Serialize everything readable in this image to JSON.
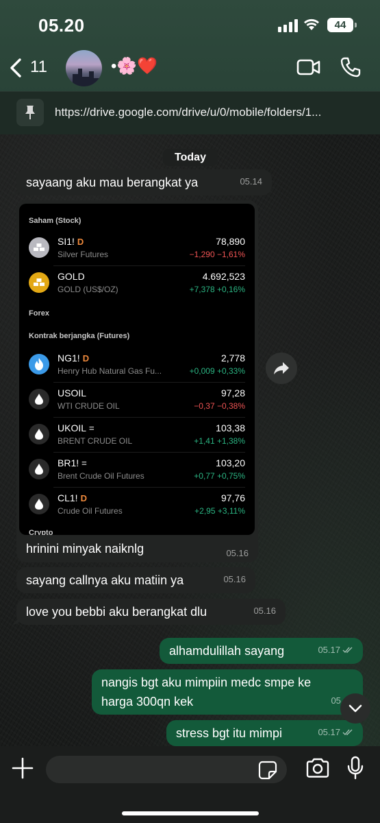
{
  "status": {
    "time": "05.20",
    "battery": "44"
  },
  "nav": {
    "back_count": "11",
    "contact_name": "•🌸❤️"
  },
  "pinned": {
    "text": "https://drive.google.com/drive/u/0/mobile/folders/1..."
  },
  "chat": {
    "date_chip": "Today",
    "messages": [
      {
        "text": "sayaang aku mau berangkat ya",
        "time": "05.14"
      },
      {
        "text": "hrinini minyak naiknlg",
        "time": "05.16"
      },
      {
        "text": "sayang callnya aku matiin ya",
        "time": "05.16"
      },
      {
        "text": "love you bebbi aku berangkat dlu",
        "time": "05.16"
      },
      {
        "text": "alhamdulillah sayang",
        "time": "05.17"
      },
      {
        "text": "nangis bgt aku mimpiin medc smpe ke",
        "text2": "harga 300qn kek",
        "time": "05.17"
      },
      {
        "text": "stress bgt itu mimpi",
        "time": "05.17"
      }
    ]
  },
  "stock_card": {
    "section_stock": "Saham (Stock)",
    "section_forex": "Forex",
    "section_futures": "Kontrak berjangka (Futures)",
    "section_crypto": "Crypto",
    "rows": [
      {
        "symbol": "SI1!",
        "flag": "D",
        "flag_color": "#f08a3c",
        "desc": "Silver Futures",
        "price": "78,890",
        "change": "−1,290 −1,61%",
        "dir": "neg",
        "icon": "silver-bars-icon",
        "icon_bg": "#b9b9c0"
      },
      {
        "symbol": "GOLD",
        "flag": "",
        "flag_color": "",
        "desc": "GOLD (US$/OZ)",
        "price": "4.692,523",
        "change": "+7,378 +0,16%",
        "dir": "pos",
        "icon": "gold-bars-icon",
        "icon_bg": "#e3a814"
      },
      {
        "symbol": "NG1!",
        "flag": "D",
        "flag_color": "#f08a3c",
        "desc": "Henry Hub Natural Gas Fu...",
        "price": "2,778",
        "change": "+0,009 +0,33%",
        "dir": "pos",
        "icon": "flame-icon",
        "icon_bg": "#3b9ae8"
      },
      {
        "symbol": "USOIL",
        "flag": "",
        "flag_color": "",
        "desc": "WTI CRUDE OIL",
        "price": "97,28",
        "change": "−0,37 −0,38%",
        "dir": "neg",
        "icon": "oil-drop-icon",
        "icon_bg": "#2a2a2a"
      },
      {
        "symbol": "UKOIL",
        "flag": "=",
        "flag_color": "#bdbdbd",
        "desc": "BRENT CRUDE OIL",
        "price": "103,38",
        "change": "+1,41 +1,38%",
        "dir": "pos",
        "icon": "oil-drop-icon",
        "icon_bg": "#2a2a2a"
      },
      {
        "symbol": "BR1!",
        "flag": "=",
        "flag_color": "#bdbdbd",
        "desc": "Brent Crude Oil Futures",
        "price": "103,20",
        "change": "+0,77 +0,75%",
        "dir": "pos",
        "icon": "oil-drop-icon",
        "icon_bg": "#2a2a2a"
      },
      {
        "symbol": "CL1!",
        "flag": "D",
        "flag_color": "#f08a3c",
        "desc": "Crude Oil Futures",
        "price": "97,76",
        "change": "+2,95 +3,11%",
        "dir": "pos",
        "icon": "oil-drop-icon",
        "icon_bg": "#2a2a2a"
      }
    ]
  },
  "colors": {
    "header": "#2a4438",
    "outgoing": "#135a3a",
    "incoming": "#222423",
    "negative": "#f05454",
    "positive": "#2bb583"
  }
}
